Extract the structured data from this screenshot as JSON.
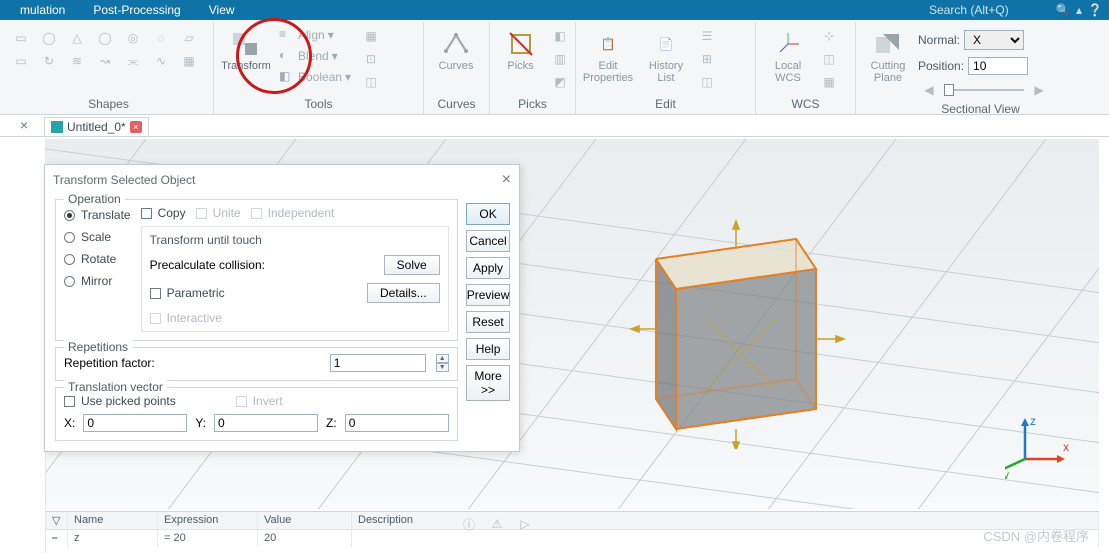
{
  "menubar": {
    "items": [
      "mulation",
      "Post-Processing",
      "View"
    ],
    "search_placeholder": "Search (Alt+Q)"
  },
  "ribbon": {
    "shapes": {
      "title": "Shapes"
    },
    "tools": {
      "title": "Tools",
      "transform": "Transform",
      "align": "Align",
      "blend": "Blend",
      "boolean": "Boolean"
    },
    "curves": {
      "title": "Curves",
      "btn": "Curves"
    },
    "picks": {
      "title": "Picks",
      "btn": "Picks"
    },
    "edit": {
      "title": "Edit",
      "props": "Edit\nProperties",
      "hist": "History\nList"
    },
    "wcs": {
      "title": "WCS",
      "local": "Local\nWCS"
    },
    "section": {
      "title": "Sectional View",
      "btn": "Cutting\nPlane",
      "normal_label": "Normal:",
      "normal_value": "X",
      "position_label": "Position:",
      "position_value": "10"
    }
  },
  "tab": {
    "name": "Untitled_0*"
  },
  "dialog": {
    "title": "Transform Selected Object",
    "operation": {
      "legend": "Operation",
      "translate": "Translate",
      "scale": "Scale",
      "rotate": "Rotate",
      "mirror": "Mirror",
      "copy": "Copy",
      "unite": "Unite",
      "independent": "Independent",
      "tut_label": "Transform until touch",
      "precalc": "Precalculate collision:",
      "solve": "Solve",
      "details": "Details...",
      "parametric": "Parametric",
      "interactive": "Interactive"
    },
    "repetitions": {
      "legend": "Repetitions",
      "factor_label": "Repetition factor:",
      "factor_value": "1"
    },
    "tvec": {
      "legend": "Translation vector",
      "upp": "Use picked points",
      "invert": "Invert",
      "x_label": "X:",
      "y_label": "Y:",
      "z_label": "Z:",
      "x": "0",
      "y": "0",
      "z": "0"
    },
    "buttons": {
      "ok": "OK",
      "cancel": "Cancel",
      "apply": "Apply",
      "preview": "Preview",
      "reset": "Reset",
      "help": "Help",
      "more": "More >>"
    }
  },
  "table": {
    "headers": {
      "name": "Name",
      "expr": "Expression",
      "value": "Value",
      "desc": "Description"
    },
    "row": {
      "name": "z",
      "expr": "= 20",
      "value": "20",
      "desc": ""
    }
  },
  "watermark": "CSDN @内卷程序"
}
